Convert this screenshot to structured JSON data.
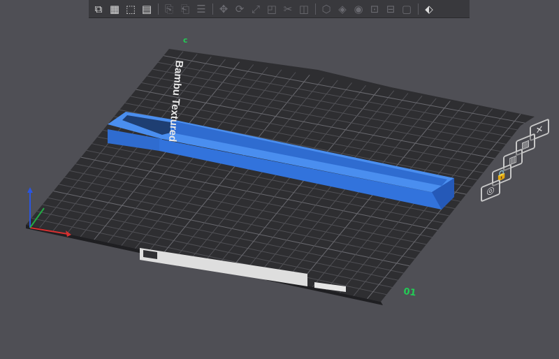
{
  "toolbar": {
    "groups": [
      [
        {
          "name": "add-part-icon",
          "glyph": "⧉",
          "dim": false
        },
        {
          "name": "grid-arrange-icon",
          "glyph": "▦",
          "dim": false
        },
        {
          "name": "orient-icon",
          "glyph": "⬚",
          "dim": false
        },
        {
          "name": "plate-layout-icon",
          "glyph": "▤",
          "dim": false
        }
      ],
      [
        {
          "name": "copy-icon",
          "glyph": "⎘",
          "dim": true
        },
        {
          "name": "paste-icon",
          "glyph": "⎗",
          "dim": true
        },
        {
          "name": "list-icon",
          "glyph": "☰",
          "dim": true
        }
      ],
      [
        {
          "name": "move-icon",
          "glyph": "✥",
          "dim": true
        },
        {
          "name": "rotate-icon",
          "glyph": "⟳",
          "dim": true
        },
        {
          "name": "scale-icon",
          "glyph": "⤢",
          "dim": true
        },
        {
          "name": "lay-on-face-icon",
          "glyph": "◰",
          "dim": true
        },
        {
          "name": "cut-icon",
          "glyph": "✂",
          "dim": true
        },
        {
          "name": "mesh-boolean-icon",
          "glyph": "◫",
          "dim": true
        }
      ],
      [
        {
          "name": "support-paint-icon",
          "glyph": "⬡",
          "dim": true
        },
        {
          "name": "seam-paint-icon",
          "glyph": "◈",
          "dim": true
        },
        {
          "name": "color-paint-icon",
          "glyph": "◉",
          "dim": true
        },
        {
          "name": "measure-icon",
          "glyph": "⊡",
          "dim": true
        },
        {
          "name": "text-emboss-icon",
          "glyph": "⊟",
          "dim": true
        },
        {
          "name": "assembly-icon",
          "glyph": "▢",
          "dim": true
        }
      ],
      [
        {
          "name": "view-settings-icon",
          "glyph": "⬖",
          "dim": false
        }
      ]
    ]
  },
  "plate": {
    "label": "Bambu Textured",
    "plate_number": "01",
    "corner_marker": "c"
  },
  "colors": {
    "background": "#4f4f55",
    "plate": "#2e2e31",
    "grid": "#58585d",
    "part": "#3d82e8",
    "part_side": "#2f6cd0",
    "accent_green": "#22cc55"
  },
  "side_panel": [
    {
      "name": "close-plate-icon",
      "glyph": "✕"
    },
    {
      "name": "plate-arrange-icon",
      "glyph": "▨"
    },
    {
      "name": "plate-orient-icon",
      "glyph": "▥"
    },
    {
      "name": "plate-lock-icon",
      "glyph": "🔒"
    },
    {
      "name": "plate-settings-icon",
      "glyph": "◎"
    }
  ]
}
